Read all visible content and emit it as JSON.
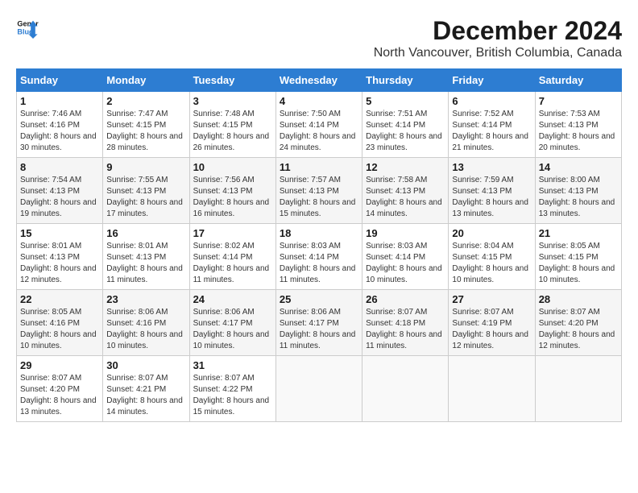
{
  "logo": {
    "line1": "General",
    "line2": "Blue"
  },
  "title": "December 2024",
  "subtitle": "North Vancouver, British Columbia, Canada",
  "days_header": [
    "Sunday",
    "Monday",
    "Tuesday",
    "Wednesday",
    "Thursday",
    "Friday",
    "Saturday"
  ],
  "weeks": [
    [
      {
        "day": "1",
        "sunrise": "Sunrise: 7:46 AM",
        "sunset": "Sunset: 4:16 PM",
        "daylight": "Daylight: 8 hours and 30 minutes."
      },
      {
        "day": "2",
        "sunrise": "Sunrise: 7:47 AM",
        "sunset": "Sunset: 4:15 PM",
        "daylight": "Daylight: 8 hours and 28 minutes."
      },
      {
        "day": "3",
        "sunrise": "Sunrise: 7:48 AM",
        "sunset": "Sunset: 4:15 PM",
        "daylight": "Daylight: 8 hours and 26 minutes."
      },
      {
        "day": "4",
        "sunrise": "Sunrise: 7:50 AM",
        "sunset": "Sunset: 4:14 PM",
        "daylight": "Daylight: 8 hours and 24 minutes."
      },
      {
        "day": "5",
        "sunrise": "Sunrise: 7:51 AM",
        "sunset": "Sunset: 4:14 PM",
        "daylight": "Daylight: 8 hours and 23 minutes."
      },
      {
        "day": "6",
        "sunrise": "Sunrise: 7:52 AM",
        "sunset": "Sunset: 4:14 PM",
        "daylight": "Daylight: 8 hours and 21 minutes."
      },
      {
        "day": "7",
        "sunrise": "Sunrise: 7:53 AM",
        "sunset": "Sunset: 4:13 PM",
        "daylight": "Daylight: 8 hours and 20 minutes."
      }
    ],
    [
      {
        "day": "8",
        "sunrise": "Sunrise: 7:54 AM",
        "sunset": "Sunset: 4:13 PM",
        "daylight": "Daylight: 8 hours and 19 minutes."
      },
      {
        "day": "9",
        "sunrise": "Sunrise: 7:55 AM",
        "sunset": "Sunset: 4:13 PM",
        "daylight": "Daylight: 8 hours and 17 minutes."
      },
      {
        "day": "10",
        "sunrise": "Sunrise: 7:56 AM",
        "sunset": "Sunset: 4:13 PM",
        "daylight": "Daylight: 8 hours and 16 minutes."
      },
      {
        "day": "11",
        "sunrise": "Sunrise: 7:57 AM",
        "sunset": "Sunset: 4:13 PM",
        "daylight": "Daylight: 8 hours and 15 minutes."
      },
      {
        "day": "12",
        "sunrise": "Sunrise: 7:58 AM",
        "sunset": "Sunset: 4:13 PM",
        "daylight": "Daylight: 8 hours and 14 minutes."
      },
      {
        "day": "13",
        "sunrise": "Sunrise: 7:59 AM",
        "sunset": "Sunset: 4:13 PM",
        "daylight": "Daylight: 8 hours and 13 minutes."
      },
      {
        "day": "14",
        "sunrise": "Sunrise: 8:00 AM",
        "sunset": "Sunset: 4:13 PM",
        "daylight": "Daylight: 8 hours and 13 minutes."
      }
    ],
    [
      {
        "day": "15",
        "sunrise": "Sunrise: 8:01 AM",
        "sunset": "Sunset: 4:13 PM",
        "daylight": "Daylight: 8 hours and 12 minutes."
      },
      {
        "day": "16",
        "sunrise": "Sunrise: 8:01 AM",
        "sunset": "Sunset: 4:13 PM",
        "daylight": "Daylight: 8 hours and 11 minutes."
      },
      {
        "day": "17",
        "sunrise": "Sunrise: 8:02 AM",
        "sunset": "Sunset: 4:14 PM",
        "daylight": "Daylight: 8 hours and 11 minutes."
      },
      {
        "day": "18",
        "sunrise": "Sunrise: 8:03 AM",
        "sunset": "Sunset: 4:14 PM",
        "daylight": "Daylight: 8 hours and 11 minutes."
      },
      {
        "day": "19",
        "sunrise": "Sunrise: 8:03 AM",
        "sunset": "Sunset: 4:14 PM",
        "daylight": "Daylight: 8 hours and 10 minutes."
      },
      {
        "day": "20",
        "sunrise": "Sunrise: 8:04 AM",
        "sunset": "Sunset: 4:15 PM",
        "daylight": "Daylight: 8 hours and 10 minutes."
      },
      {
        "day": "21",
        "sunrise": "Sunrise: 8:05 AM",
        "sunset": "Sunset: 4:15 PM",
        "daylight": "Daylight: 8 hours and 10 minutes."
      }
    ],
    [
      {
        "day": "22",
        "sunrise": "Sunrise: 8:05 AM",
        "sunset": "Sunset: 4:16 PM",
        "daylight": "Daylight: 8 hours and 10 minutes."
      },
      {
        "day": "23",
        "sunrise": "Sunrise: 8:06 AM",
        "sunset": "Sunset: 4:16 PM",
        "daylight": "Daylight: 8 hours and 10 minutes."
      },
      {
        "day": "24",
        "sunrise": "Sunrise: 8:06 AM",
        "sunset": "Sunset: 4:17 PM",
        "daylight": "Daylight: 8 hours and 10 minutes."
      },
      {
        "day": "25",
        "sunrise": "Sunrise: 8:06 AM",
        "sunset": "Sunset: 4:17 PM",
        "daylight": "Daylight: 8 hours and 11 minutes."
      },
      {
        "day": "26",
        "sunrise": "Sunrise: 8:07 AM",
        "sunset": "Sunset: 4:18 PM",
        "daylight": "Daylight: 8 hours and 11 minutes."
      },
      {
        "day": "27",
        "sunrise": "Sunrise: 8:07 AM",
        "sunset": "Sunset: 4:19 PM",
        "daylight": "Daylight: 8 hours and 12 minutes."
      },
      {
        "day": "28",
        "sunrise": "Sunrise: 8:07 AM",
        "sunset": "Sunset: 4:20 PM",
        "daylight": "Daylight: 8 hours and 12 minutes."
      }
    ],
    [
      {
        "day": "29",
        "sunrise": "Sunrise: 8:07 AM",
        "sunset": "Sunset: 4:20 PM",
        "daylight": "Daylight: 8 hours and 13 minutes."
      },
      {
        "day": "30",
        "sunrise": "Sunrise: 8:07 AM",
        "sunset": "Sunset: 4:21 PM",
        "daylight": "Daylight: 8 hours and 14 minutes."
      },
      {
        "day": "31",
        "sunrise": "Sunrise: 8:07 AM",
        "sunset": "Sunset: 4:22 PM",
        "daylight": "Daylight: 8 hours and 15 minutes."
      },
      null,
      null,
      null,
      null
    ]
  ]
}
